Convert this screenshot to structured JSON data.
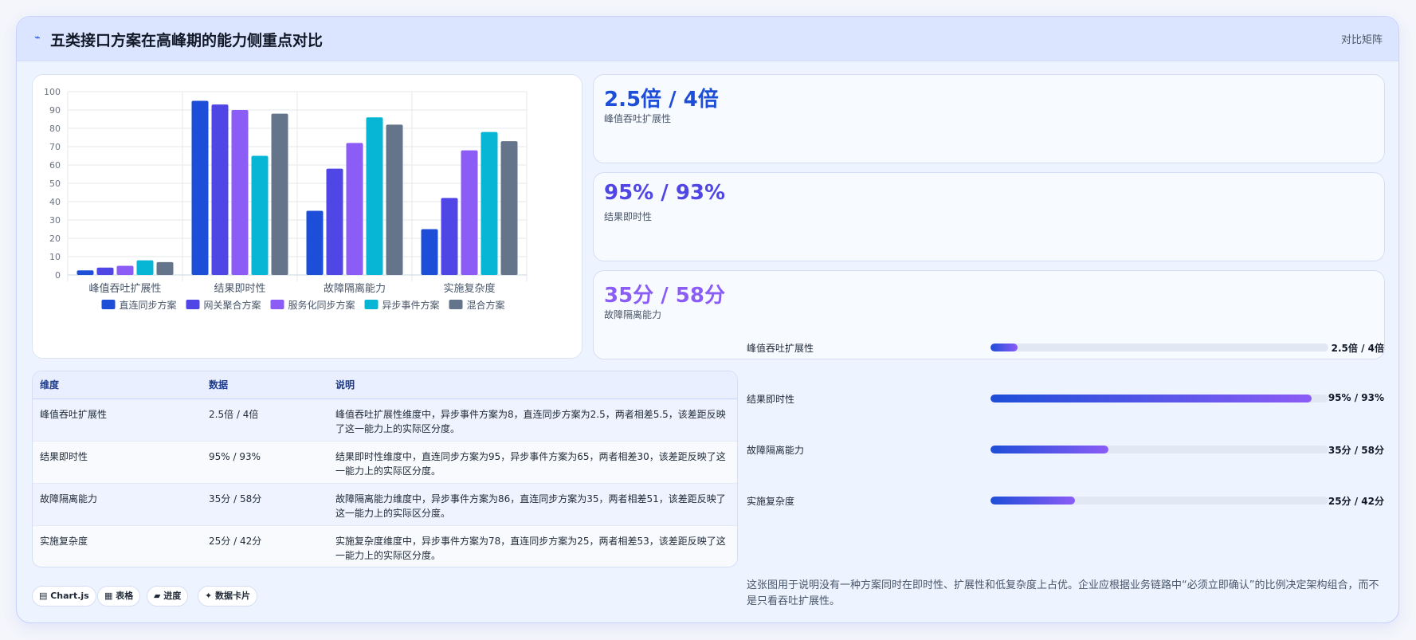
{
  "header": {
    "logo": "⌁",
    "title": "五类接口方案在高峰期的能力侧重点对比",
    "tag": "对比矩阵"
  },
  "chart_data": {
    "type": "bar",
    "categories": [
      "峰值吞吐扩展性",
      "结果即时性",
      "故障隔离能力",
      "实施复杂度"
    ],
    "ylim": [
      0,
      100
    ],
    "yticks": [
      0,
      10,
      20,
      30,
      40,
      50,
      60,
      70,
      80,
      90,
      100
    ],
    "grid": true,
    "legend_position": "bottom",
    "series": [
      {
        "name": "直连同步方案",
        "color": "#1d4ed8",
        "values": [
          2.5,
          95,
          35,
          25
        ]
      },
      {
        "name": "网关聚合方案",
        "color": "#4f46e5",
        "values": [
          4,
          93,
          58,
          42
        ]
      },
      {
        "name": "服务化同步方案",
        "color": "#8b5cf6",
        "values": [
          5,
          90,
          72,
          68
        ]
      },
      {
        "name": "异步事件方案",
        "color": "#06b6d4",
        "values": [
          8,
          65,
          86,
          78
        ]
      },
      {
        "name": "混合方案",
        "color": "#64748b",
        "values": [
          7,
          88,
          82,
          73
        ]
      }
    ]
  },
  "stats": [
    {
      "value": "2.5倍 / 4倍",
      "label": "峰值吞吐扩展性",
      "color": "#1d4ed8"
    },
    {
      "value": "95% / 93%",
      "label": "结果即时性",
      "color": "#4f46e5"
    },
    {
      "value": "35分 / 58分",
      "label": "故障隔离能力",
      "color": "#8b5cf6"
    }
  ],
  "table": {
    "headers": [
      "维度",
      "数据",
      "说明"
    ],
    "rows": [
      [
        "峰值吞吐扩展性",
        "2.5倍 / 4倍",
        "峰值吞吐扩展性维度中，异步事件方案为8，直连同步方案为2.5，两者相差5.5，该差距反映了这一能力上的实际区分度。"
      ],
      [
        "结果即时性",
        "95% / 93%",
        "结果即时性维度中，直连同步方案为95，异步事件方案为65，两者相差30，该差距反映了这一能力上的实际区分度。"
      ],
      [
        "故障隔离能力",
        "35分 / 58分",
        "故障隔离能力维度中，异步事件方案为86，直连同步方案为35，两者相差51，该差距反映了这一能力上的实际区分度。"
      ],
      [
        "实施复杂度",
        "25分 / 42分",
        "实施复杂度维度中，异步事件方案为78，直连同步方案为25，两者相差53，该差距反映了这一能力上的实际区分度。"
      ]
    ]
  },
  "progress": [
    {
      "label": "峰值吞吐扩展性",
      "value": "2.5倍 / 4倍",
      "fraction": 0.08
    },
    {
      "label": "结果即时性",
      "value": "95% / 93%",
      "fraction": 0.95
    },
    {
      "label": "故障隔离能力",
      "value": "35分 / 58分",
      "fraction": 0.35
    },
    {
      "label": "实施复杂度",
      "value": "25分 / 42分",
      "fraction": 0.25
    }
  ],
  "chips": [
    {
      "label": "▤ Chart.js"
    },
    {
      "label": "▦ 表格"
    },
    {
      "label": "▰ 进度"
    },
    {
      "label": "✦ 数据卡片"
    }
  ],
  "note": "这张图用于说明没有一种方案同时在即时性、扩展性和低复杂度上占优。企业应根据业务链路中“必须立即确认”的比例决定架构组合，而不是只看吞吐扩展性。"
}
